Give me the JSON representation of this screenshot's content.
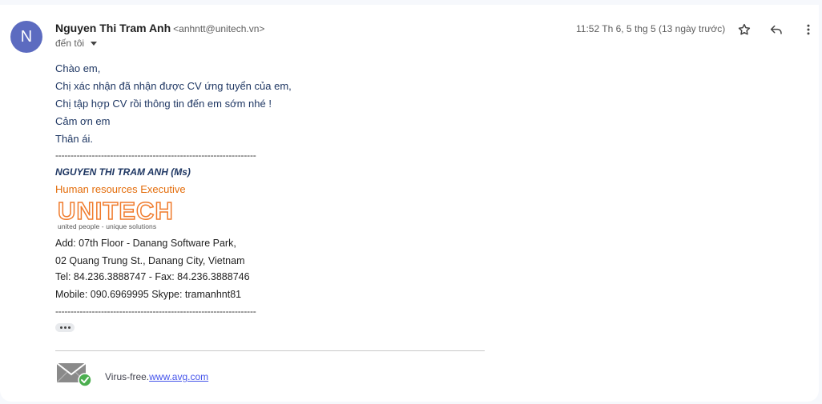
{
  "sender": {
    "initial": "N",
    "name": "Nguyen Thi Tram Anh",
    "email": "<anhntt@unitech.vn>",
    "to": "đến tôi"
  },
  "timestamp": "11:52 Th 6, 5 thg 5 (13 ngày trước)",
  "actions": {
    "star_icon": "star-icon",
    "reply_icon": "reply-icon",
    "more_icon": "more-vert-icon"
  },
  "body": {
    "lines": [
      "Chào em,",
      "Chị xác nhận đã nhận được CV ứng tuyển của em,",
      "Chị tập hợp CV rồi thông tin đến em sớm nhé !",
      "Cảm ơn em",
      "Thân ái."
    ]
  },
  "signature": {
    "dashes": "------------------------------------------------------------------",
    "name": "NGUYEN THI TRAM ANH (Ms)",
    "title": "Human resources Executive",
    "logo_word": "UNITECH",
    "logo_tagline": "united people - unique solutions",
    "address1": "Add: 07th Floor - Danang Software Park,",
    "address2": "02 Quang Trung St., Danang City, Vietnam",
    "phone": "Tel: 84.236.3888747 - Fax: 84.236.3888746",
    "mobile": "Mobile: 090.6969995  Skype: tramanhnt81"
  },
  "footer": {
    "virus_free": "Virus-free.",
    "link": "www.avg.com"
  },
  "colors": {
    "avatar": "#5c6bc0",
    "body_text": "#1f3763",
    "title_orange": "#e36c0a",
    "logo_orange": "#f07b2c",
    "link": "#4453ea"
  }
}
